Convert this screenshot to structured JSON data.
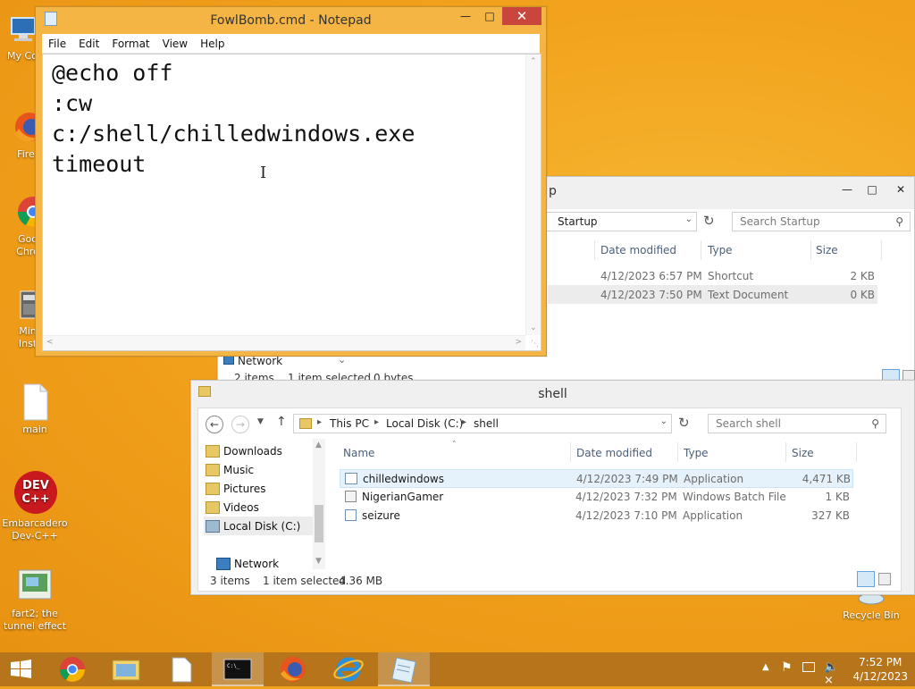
{
  "desktop": {
    "icons": [
      {
        "label": "My Co"
      },
      {
        "label": "Fire"
      },
      {
        "label": "Goo\nChro"
      },
      {
        "label": "Min\nInst"
      },
      {
        "label": "main"
      },
      {
        "label": "Embarcadero\nDev-C++"
      },
      {
        "label": "fart2; the\ntunnel effect"
      },
      {
        "label": "Recycle Bin"
      }
    ],
    "devcpp_badge": "DEV\nC++"
  },
  "notepad": {
    "title": "FowlBomb.cmd - Notepad",
    "menu": [
      "File",
      "Edit",
      "Format",
      "View",
      "Help"
    ],
    "content": "@echo off\n:cw\nc:/shell/chilledwindows.exe\ntimeout"
  },
  "startup": {
    "title_fragment": "p",
    "address": "Startup",
    "search_placeholder": "Search Startup",
    "columns": [
      "Date modified",
      "Type",
      "Size"
    ],
    "rows": [
      {
        "date": "4/12/2023 6:57 PM",
        "type": "Shortcut",
        "size": "2 KB"
      },
      {
        "date": "4/12/2023 7:50 PM",
        "type": "Text Document",
        "size": "0 KB"
      }
    ],
    "nav_network": "Network",
    "status": {
      "items": "2 items",
      "selected": "1 item selected",
      "bytes": "0 bytes"
    }
  },
  "shell": {
    "title": "shell",
    "breadcrumb": [
      "This PC",
      "Local Disk (C:)",
      "shell"
    ],
    "search_placeholder": "Search shell",
    "columns": [
      "Name",
      "Date modified",
      "Type",
      "Size"
    ],
    "nav": [
      "Downloads",
      "Music",
      "Pictures",
      "Videos",
      "Local Disk (C:)",
      "Network"
    ],
    "rows": [
      {
        "name": "chilledwindows",
        "date": "4/12/2023 7:49 PM",
        "type": "Application",
        "size": "4,471 KB"
      },
      {
        "name": "NigerianGamer",
        "date": "4/12/2023 7:32 PM",
        "type": "Windows Batch File",
        "size": "1 KB"
      },
      {
        "name": "seizure",
        "date": "4/12/2023 7:10 PM",
        "type": "Application",
        "size": "327 KB"
      }
    ],
    "status": {
      "items": "3 items",
      "selected": "1 item selected",
      "size": "4.36 MB"
    }
  },
  "taskbar": {
    "clock_time": "7:52 PM",
    "clock_date": "4/12/2023"
  },
  "colors": {
    "desktop": "#f2a31d",
    "taskbar": "#b6751b",
    "title_active": "#f2b23f",
    "close_button": "#c9463d"
  }
}
